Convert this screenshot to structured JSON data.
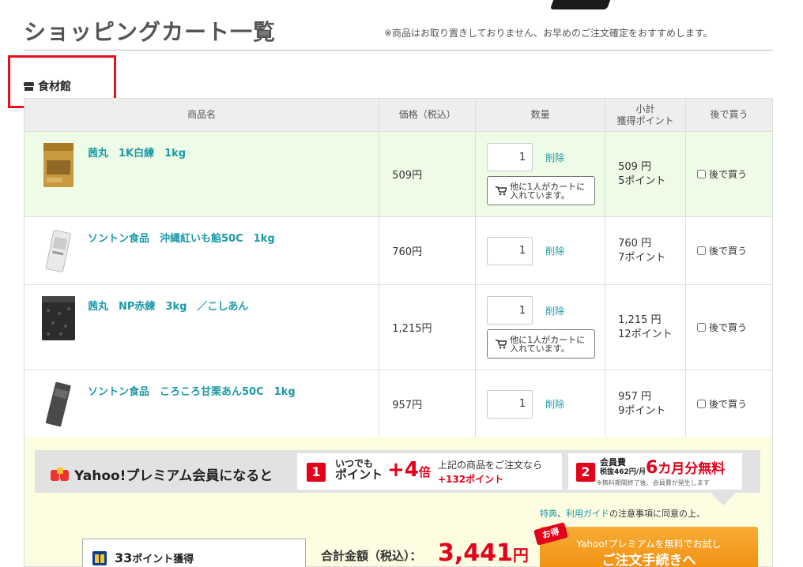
{
  "page": {
    "title": "ショッピングカート一覧",
    "notice": "※商品はお取り置きしておりません、お早めのご注文確定をおすすめします。"
  },
  "store": {
    "name": "食材館"
  },
  "table": {
    "headers": {
      "product": "商品名",
      "price": "価格（税込）",
      "quantity": "数量",
      "subtotal_line1": "小計",
      "subtotal_line2": "獲得ポイント",
      "later": "後で買う"
    },
    "delete_label": "削除",
    "later_label": "後で買う",
    "others_line1": "他に1人がカートに",
    "others_line2": "入れています。",
    "rows": [
      {
        "name": "茜丸　1K白練　1kg",
        "price": "509円",
        "qty": "1",
        "subtotal": "509 円",
        "points": "5ポイント",
        "others": true
      },
      {
        "name": "ソントン食品　沖縄紅いも餡50C　1kg",
        "price": "760円",
        "qty": "1",
        "subtotal": "760 円",
        "points": "7ポイント",
        "others": false
      },
      {
        "name": "茜丸　NP赤練　3kg　／こしあん",
        "price": "1,215円",
        "qty": "1",
        "subtotal": "1,215 円",
        "points": "12ポイント",
        "others": true
      },
      {
        "name": "ソントン食品　ころころ甘栗あん50C　1kg",
        "price": "957円",
        "qty": "1",
        "subtotal": "957 円",
        "points": "9ポイント",
        "others": false
      }
    ]
  },
  "promo": {
    "title": "Yahoo!プレミアム会員になると",
    "b1_num": "1",
    "b1_small1": "いつでも",
    "b1_small2": "ポイント",
    "b1_big": "+4",
    "b1_big_unit": "倍",
    "b1_note1": "上記の商品をご注文なら",
    "b1_note2": "+132ポイント",
    "b2_num": "2",
    "b2_t1": "会員費",
    "b2_t2": "税抜462円/月",
    "b2_big_num": "6",
    "b2_big_rest": "カ月分無料",
    "b2_note": "※無料期間終了後、会員費が発生します",
    "terms_link1": "特典",
    "terms_sep": "、",
    "terms_link2": "利用ガイド",
    "terms_rest": "の注意事項に同意の上、"
  },
  "summary": {
    "points_value": "33",
    "points_unit": "ポイント獲得",
    "total_label": "合計金額（税込）：",
    "total_value": "3,441",
    "total_unit": "円",
    "otoku": "お得",
    "checkout_line1": "Yahoo!プレミアムを無料でお試し",
    "checkout_line2": "ご注文手続きへ"
  },
  "colors": {
    "accent": "#1b9aa8",
    "price_red": "#e3001b",
    "highlight_row": "#eefbe6",
    "annotation_box": "#e8101a"
  }
}
